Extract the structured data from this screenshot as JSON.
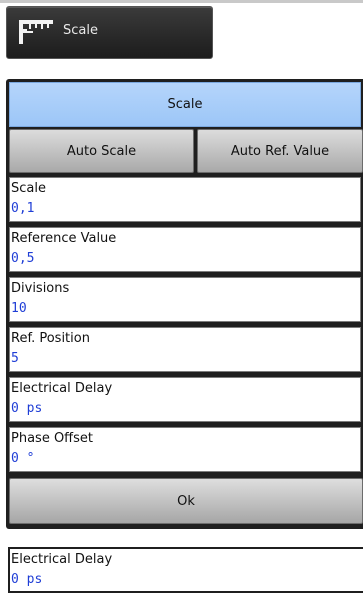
{
  "top_button": {
    "label": "Scale",
    "icon": "scale-ruler-icon"
  },
  "panel": {
    "title": "Scale",
    "buttons": {
      "auto_scale": "Auto Scale",
      "auto_ref_value": "Auto Ref. Value"
    },
    "fields": [
      {
        "label": "Scale",
        "value": "0,1"
      },
      {
        "label": "Reference Value",
        "value": "0,5"
      },
      {
        "label": "Divisions",
        "value": "10"
      },
      {
        "label": "Ref. Position",
        "value": "5"
      },
      {
        "label": "Electrical Delay",
        "value": "0 ps"
      },
      {
        "label": "Phase Offset",
        "value": "0 °"
      }
    ],
    "ok_label": "Ok"
  },
  "bottom_field": {
    "label": "Electrical Delay",
    "value": "0 ps"
  },
  "colors": {
    "title_bar": "#9cc6f7",
    "value_text": "#1f3ed6",
    "panel_bg": "#1f1f1f"
  }
}
